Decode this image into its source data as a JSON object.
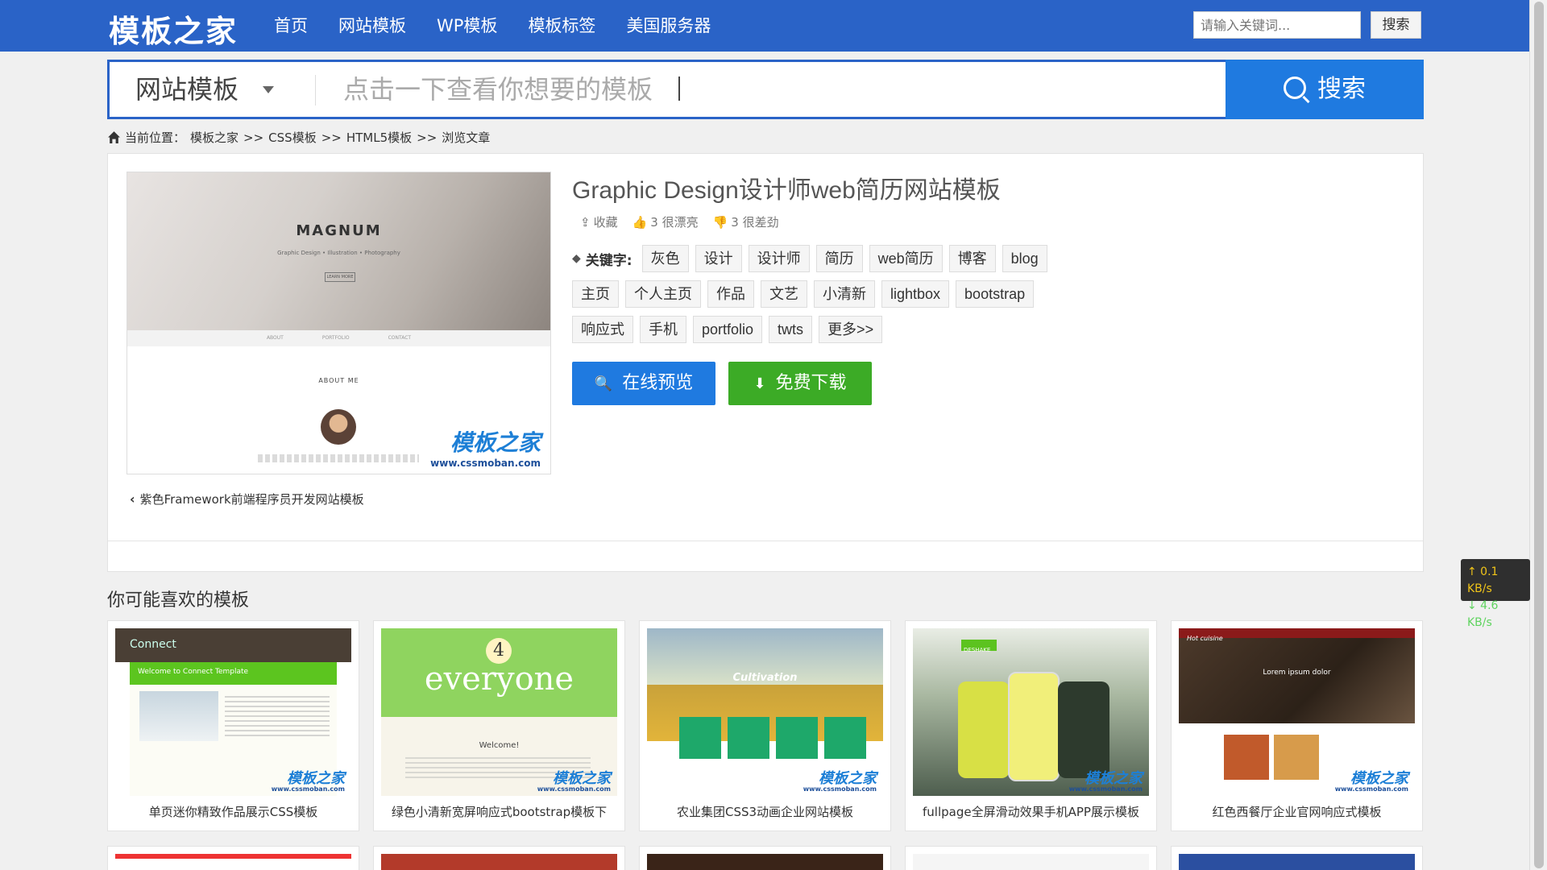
{
  "nav": {
    "logo": "模板之家",
    "links": [
      "首页",
      "网站模板",
      "WP模板",
      "模板标签",
      "美国服务器"
    ],
    "search_placeholder": "请输入关键词...",
    "search_button": "搜索"
  },
  "bigsearch": {
    "category": "网站模板",
    "placeholder": "点击一下查看你想要的模板",
    "button": "搜索"
  },
  "breadcrumb": {
    "prefix": "当前位置：",
    "items": [
      "模板之家",
      ">>",
      "CSS模板",
      ">>",
      "HTML5模板",
      ">>",
      "浏览文章"
    ]
  },
  "detail": {
    "title": "Graphic Design设计师web简历网站模板",
    "meta": {
      "favorite": "收藏",
      "likes": "3 很漂亮",
      "dislikes": "3 很差劲"
    },
    "keywords_label": "关键字:",
    "tags": [
      "灰色",
      "设计",
      "设计师",
      "简历",
      "web简历",
      "博客",
      "blog",
      "主页",
      "个人主页",
      "作品",
      "文艺",
      "小清新",
      "lightbox",
      "bootstrap",
      "响应式",
      "手机",
      "portfolio",
      "twts",
      "更多>>"
    ],
    "preview_button": "在线预览",
    "download_button": "免费下载",
    "prev_link": "紫色Framework前端程序员开发网站模板",
    "thumb": {
      "brand": "MAGNUM",
      "subtitle": "Graphic Design • Illustration • Photography",
      "btn": "LEARN MORE",
      "menu": [
        "ABOUT",
        "PORTFOLIO",
        "CONTACT"
      ],
      "about": "ABOUT ME",
      "wm1": "模板之家",
      "wm2": "www.cssmoban.com"
    }
  },
  "netspeed": {
    "up": "↑ 0.1 KB/s",
    "down": "↓ 4.6 KB/s"
  },
  "recommend": {
    "title": "你可能喜欢的模板",
    "items": [
      {
        "caption": "单页迷你精致作品展示CSS模板",
        "label": "Connect",
        "sub": "Welcome to Connect Template"
      },
      {
        "caption": "绿色小清新宽屏响应式bootstrap模板下",
        "label": "everyone",
        "num": "4",
        "sub": "Welcome!"
      },
      {
        "caption": "农业集团CSS3动画企业网站模板",
        "label": "Cultivation"
      },
      {
        "caption": "fullpage全屏滑动效果手机APP展示模板",
        "label": "DESHAKE"
      },
      {
        "caption": "红色西餐厅企业官网响应式模板",
        "label": "Lorem ipsum dolor",
        "sub": "Hot cuisine"
      }
    ],
    "watermark1": "模板之家",
    "watermark2": "www.cssmoban.com"
  }
}
